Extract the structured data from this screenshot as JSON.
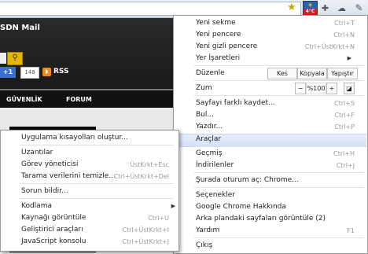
{
  "toolbar": {
    "star_icon": "star-icon",
    "weather": {
      "temp": "4°C"
    },
    "icons": [
      "puzzle-icon",
      "cloud-icon",
      "wrench-icon"
    ]
  },
  "page": {
    "header_title": "SDN Mail",
    "gplus": "+1",
    "count": "148",
    "rss": "RSS",
    "nav": [
      "GÜVENLİK",
      "FORUM"
    ]
  },
  "main_menu": {
    "new_tab": {
      "label": "Yeni sekme",
      "shortcut": "Ctrl+T"
    },
    "new_window": {
      "label": "Yeni pencere",
      "shortcut": "Ctrl+N"
    },
    "incognito": {
      "label": "Yeni gizli pencere",
      "shortcut": "Ctrl+ÜstKrkt+N"
    },
    "bookmarks": {
      "label": "Yer İşaretleri"
    },
    "edit": {
      "label": "Düzenle",
      "cut": "Kes",
      "copy": "Kopyala",
      "paste": "Yapıştır"
    },
    "zoom": {
      "label": "Zum",
      "minus": "−",
      "value": "%100",
      "plus": "+"
    },
    "save_page": {
      "label": "Sayfayı farklı kaydet...",
      "shortcut": "Ctrl+S"
    },
    "find": {
      "label": "Bul...",
      "shortcut": "Ctrl+F"
    },
    "print": {
      "label": "Yazdır...",
      "shortcut": "Ctrl+P"
    },
    "tools": {
      "label": "Araçlar"
    },
    "history": {
      "label": "Geçmiş",
      "shortcut": "Ctrl+H"
    },
    "downloads": {
      "label": "İndirilenler",
      "shortcut": "Ctrl+J"
    },
    "signin": {
      "label": "Şurada oturum aç: Chrome..."
    },
    "settings": {
      "label": "Seçenekler"
    },
    "about": {
      "label": "Google Chrome Hakkında"
    },
    "background_pages": {
      "label": "Arka plandaki sayfaları görüntüle (2)"
    },
    "help": {
      "label": "Yardım",
      "shortcut": "F1"
    },
    "exit": {
      "label": "Çıkış"
    }
  },
  "sub_menu": {
    "create_shortcuts": {
      "label": "Uygulama kısayolları oluştur..."
    },
    "extensions": {
      "label": "Uzantılar"
    },
    "task_manager": {
      "label": "Görev yöneticisi",
      "shortcut": "ÜstKrkt+Esc"
    },
    "clear_data": {
      "label": "Tarama verilerini temizle...",
      "shortcut": "Ctrl+ÜstKrkt+Del"
    },
    "report_issue": {
      "label": "Sorun bildir..."
    },
    "encoding": {
      "label": "Kodlama"
    },
    "view_source": {
      "label": "Kaynağı görüntüle",
      "shortcut": "Ctrl+U"
    },
    "dev_tools": {
      "label": "Geliştirici araçları",
      "shortcut": "Ctrl+ÜstKrkt+I"
    },
    "js_console": {
      "label": "JavaScript konsolu",
      "shortcut": "Ctrl+ÜstKrkt+J"
    }
  }
}
